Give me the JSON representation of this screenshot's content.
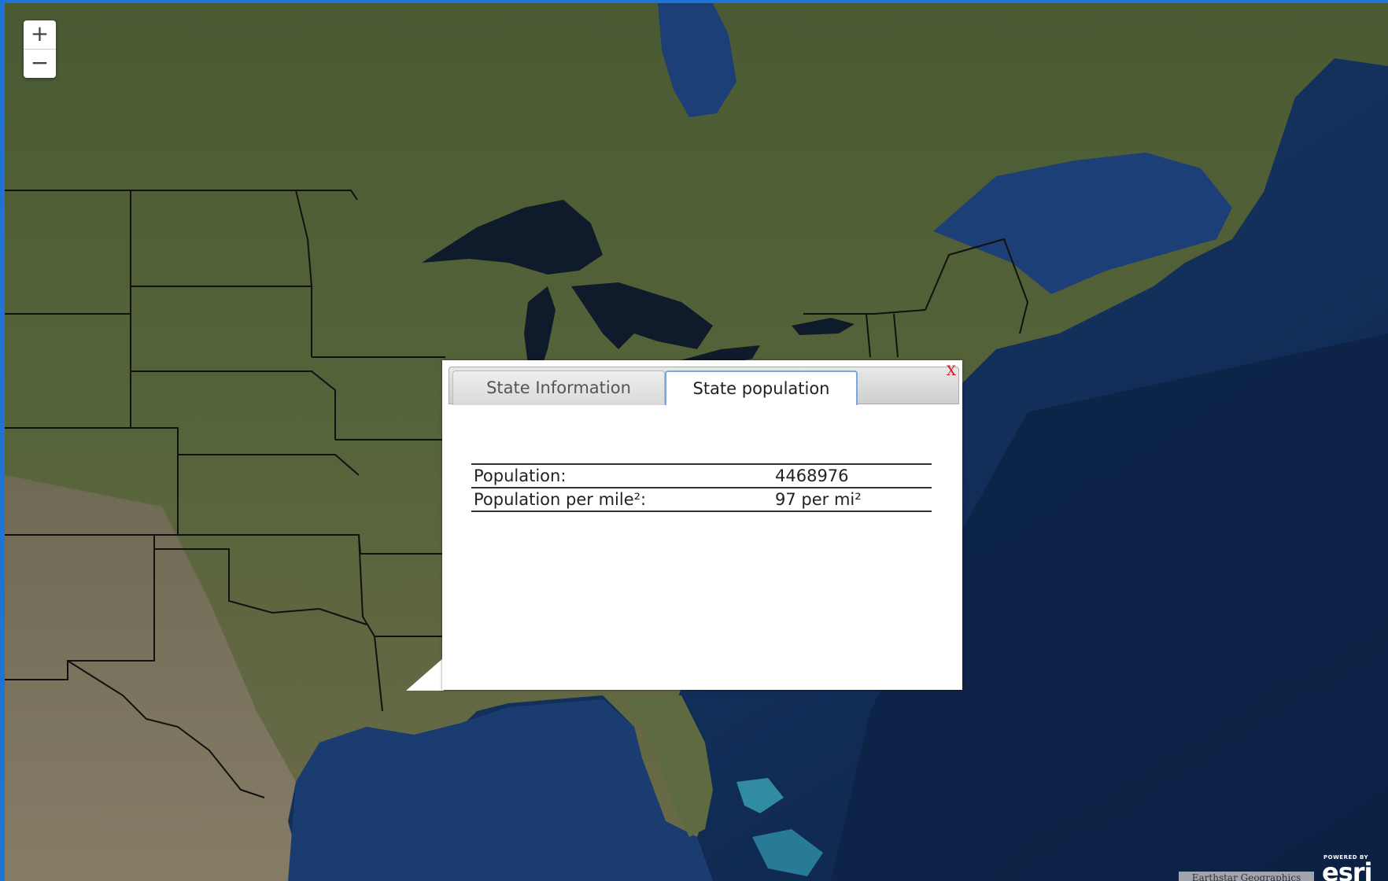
{
  "zoom": {
    "in_label": "+",
    "out_label": "−"
  },
  "popup": {
    "close_label": "X",
    "tabs": [
      {
        "label": "State Information",
        "active": false
      },
      {
        "label": "State population",
        "active": true
      }
    ],
    "rows": [
      {
        "label": "Population:",
        "value": "4468976"
      },
      {
        "label": "Population per mile²:",
        "value": "97 per mi²"
      }
    ]
  },
  "attribution": "Earthstar Geographics",
  "brand": {
    "powered_by": "POWERED BY",
    "logo": "esri"
  },
  "icons": {
    "zoom_in": "plus-icon",
    "zoom_out": "minus-icon",
    "close": "close-x-icon"
  }
}
